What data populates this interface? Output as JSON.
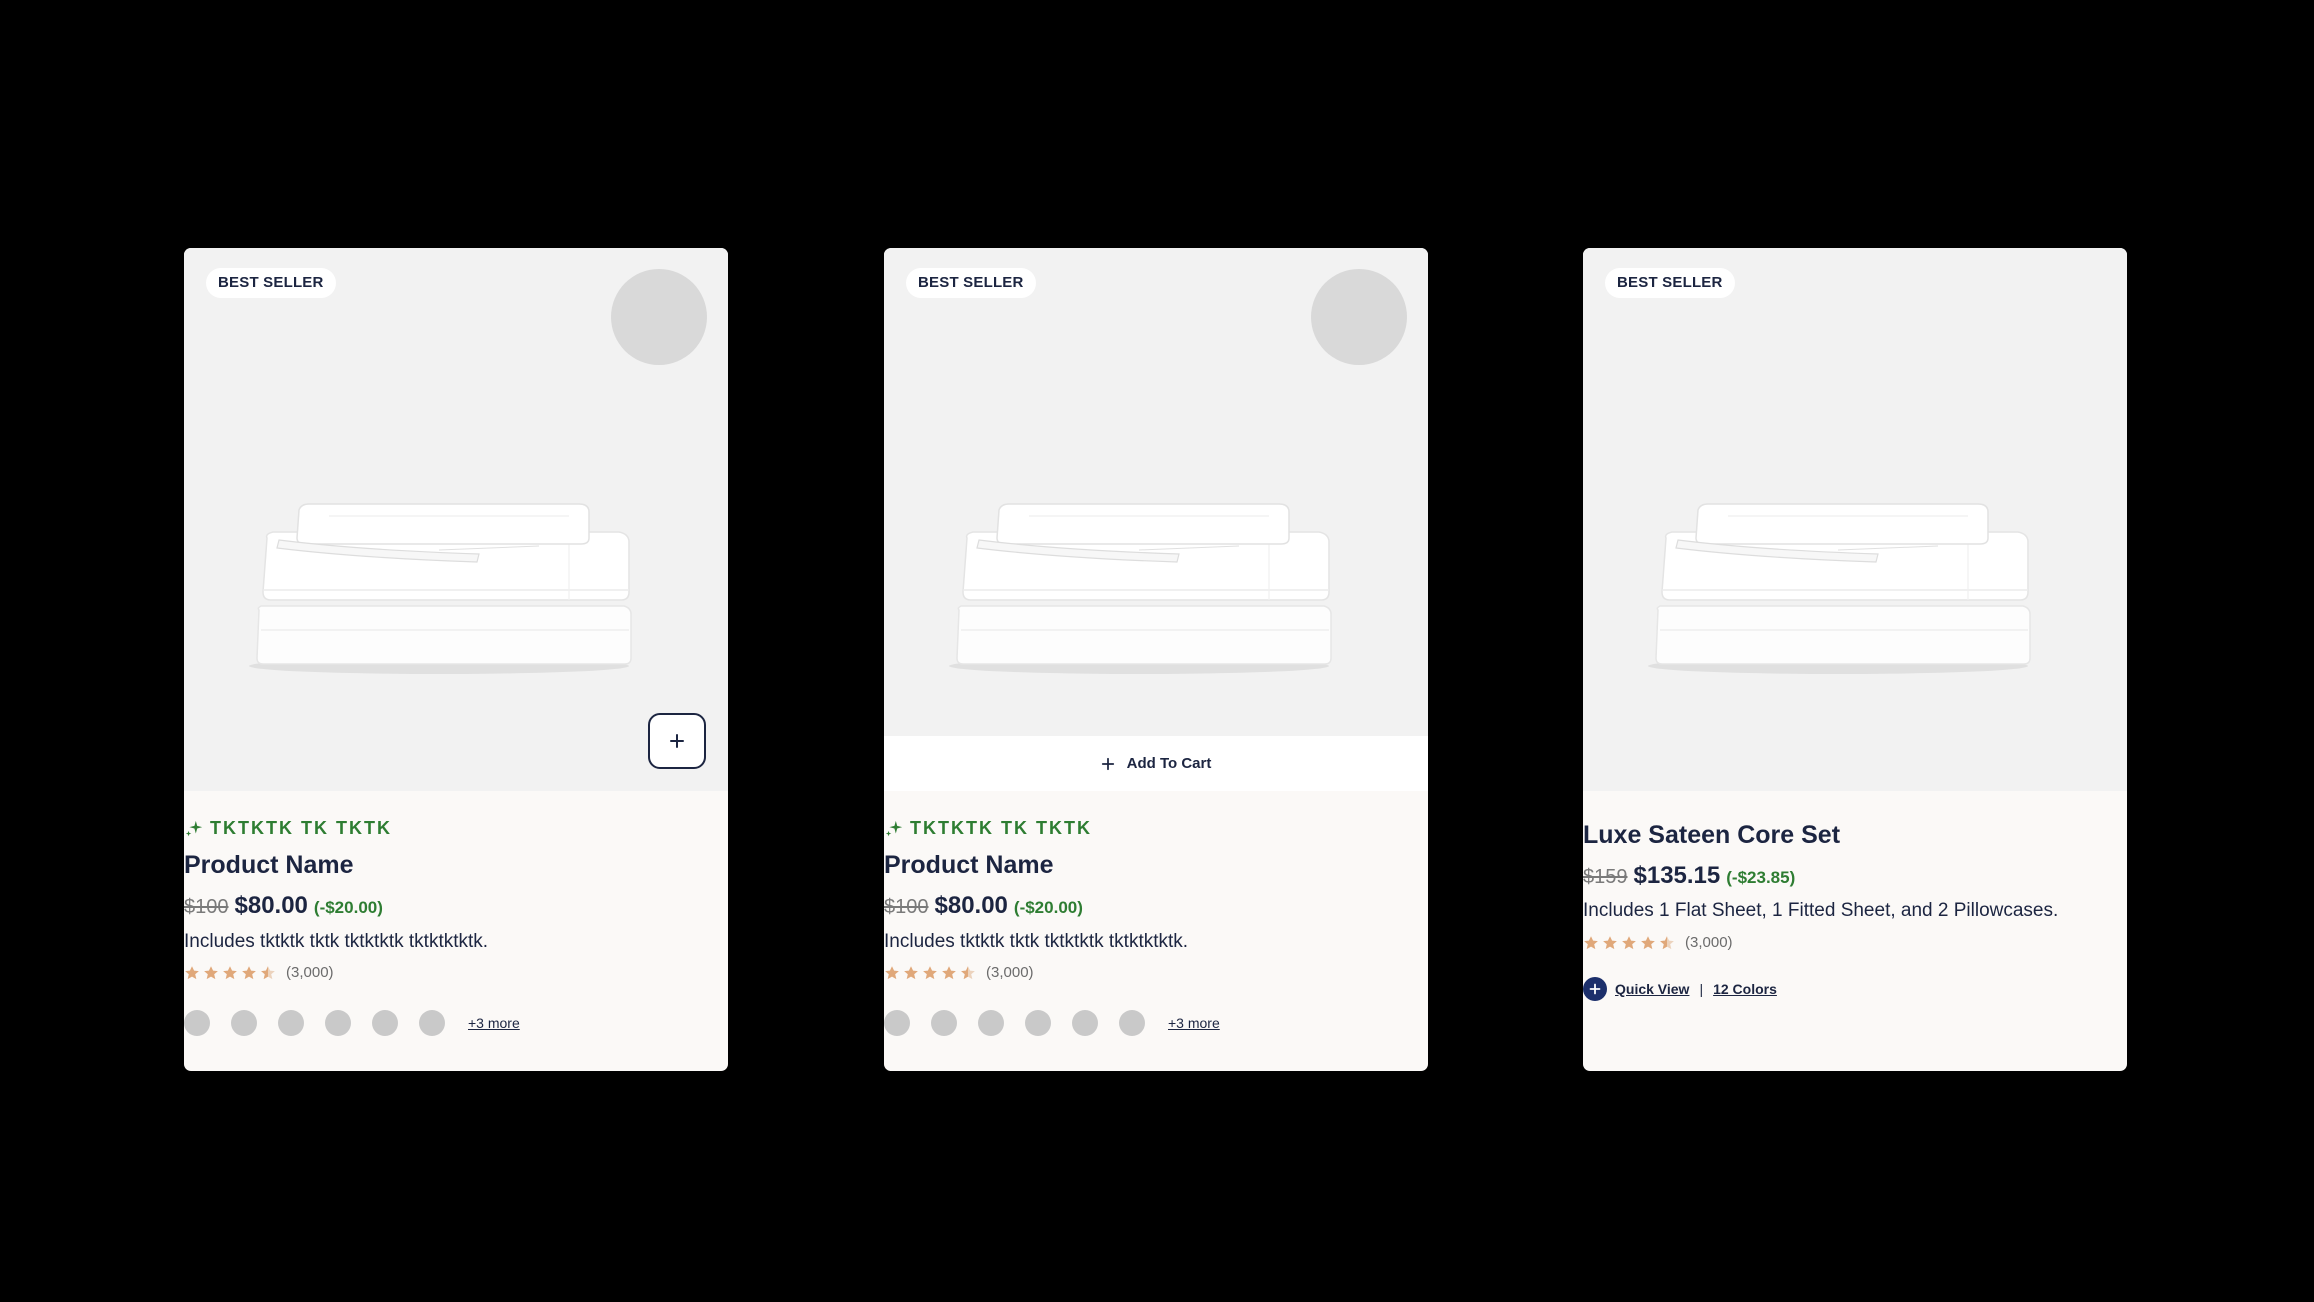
{
  "cards": [
    {
      "badge": "BEST SELLER",
      "promo": "TKTKTK TK TKTK",
      "name": "Product Name",
      "price_old": "$100",
      "price_new": "$80.00",
      "price_save": "(-$20.00)",
      "description": "Includes tktktk tktk tktktktk tktktktktk.",
      "rating": 4.5,
      "rating_count": "(3,000)",
      "more_colors": "+3 more",
      "action": "quick-add-plus"
    },
    {
      "badge": "BEST SELLER",
      "promo": "TKTKTK TK TKTK",
      "name": "Product Name",
      "price_old": "$100",
      "price_new": "$80.00",
      "price_save": "(-$20.00)",
      "description": "Includes tktktk tktk tktktktk tktktktktk.",
      "rating": 4.5,
      "rating_count": "(3,000)",
      "more_colors": "+3 more",
      "add_to_cart": "Add To Cart"
    },
    {
      "badge": "BEST SELLER",
      "name": "Luxe Sateen Core Set",
      "price_old": "$159",
      "price_new": "$135.15",
      "price_save": "(-$23.85)",
      "description": "Includes 1 Flat Sheet, 1 Fitted Sheet, and 2 Pillowcases.",
      "rating": 4.5,
      "rating_count": "(3,000)",
      "quick_view": "Quick View",
      "separator": "|",
      "colors_count": "12 Colors"
    }
  ],
  "colors": {
    "navy": "#1c2541",
    "promo_green": "#2e7d32",
    "star": "#e0a87a",
    "image_bg": "#f2f2f2",
    "card_bg": "#fbf9f7"
  },
  "icons": [
    "sparkle-icon",
    "plus-icon",
    "star-icon",
    "plus-circle-icon"
  ]
}
